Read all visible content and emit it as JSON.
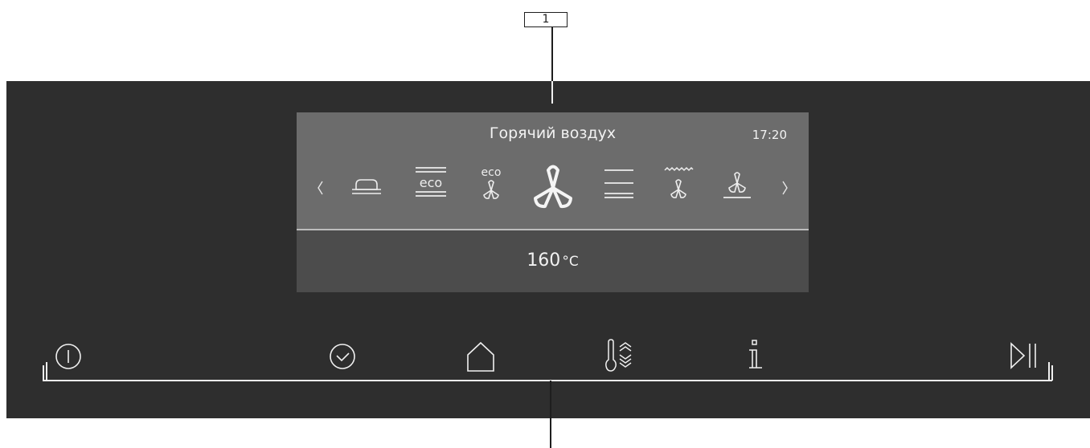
{
  "callout": {
    "label": "1"
  },
  "display": {
    "mode_title": "Горячий воздух",
    "time": "17:20",
    "temperature_value": "160",
    "temperature_unit": "°C",
    "modes": [
      {
        "icon": "chevron-left-icon"
      },
      {
        "icon": "bottom-heat-pan-icon"
      },
      {
        "icon": "eco-top-bottom-heat-icon",
        "text": "eco"
      },
      {
        "icon": "eco-hot-air-icon",
        "text": "eco"
      },
      {
        "icon": "hot-air-fan-icon",
        "selected": true
      },
      {
        "icon": "top-bottom-heat-icon"
      },
      {
        "icon": "grill-fan-icon"
      },
      {
        "icon": "bottom-heat-fan-icon"
      },
      {
        "icon": "chevron-right-icon"
      }
    ]
  },
  "panel_buttons": [
    {
      "name": "power-button",
      "icon": "power-icon"
    },
    {
      "name": "timer-button",
      "icon": "clock-icon"
    },
    {
      "name": "home-button",
      "icon": "home-icon"
    },
    {
      "name": "preheat-button",
      "icon": "thermometer-preheat-icon"
    },
    {
      "name": "info-button",
      "icon": "info-icon"
    },
    {
      "name": "start-pause-button",
      "icon": "play-pause-icon"
    }
  ],
  "colors": {
    "panel": "#2e2e2e",
    "screen_upper": "#6c6c6c",
    "screen_lower": "#4c4c4c",
    "foreground": "#f2f2f2"
  }
}
